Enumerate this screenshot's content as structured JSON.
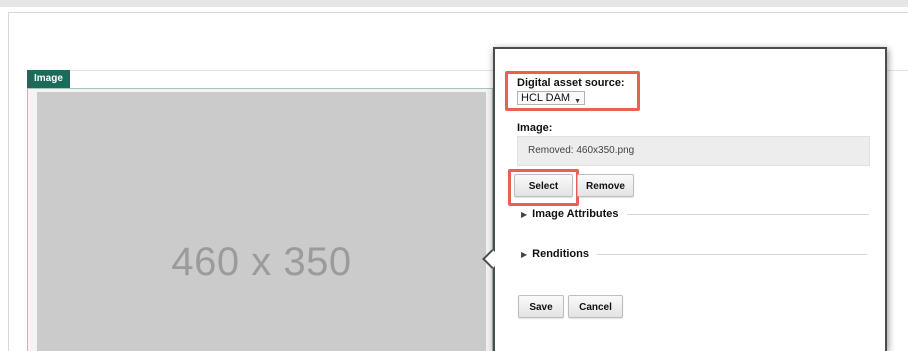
{
  "canvas": {
    "image_tag": "Image",
    "placeholder_text": "460 x 350"
  },
  "popup": {
    "digital_asset_source_label": "Digital asset source:",
    "digital_asset_source_value": "HCL DAM",
    "image_label": "Image:",
    "image_value": "Removed: 460x350.png",
    "select_label": "Select",
    "remove_label": "Remove",
    "section_image_attributes": "Image Attributes",
    "section_renditions": "Renditions",
    "save_label": "Save",
    "cancel_label": "Cancel"
  },
  "colors": {
    "highlight": "#ea6154",
    "image_tag_bg": "#1c6b5a",
    "placeholder_bg": "#cbcbcb"
  }
}
